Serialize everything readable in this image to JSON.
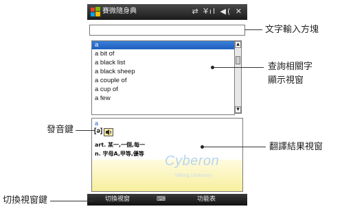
{
  "window": {
    "title": "賽微隨身典",
    "status_icons": "⇄ Y̶ıl ◀( ✕"
  },
  "input": {
    "value": ""
  },
  "word_list": {
    "items": [
      "a",
      "a bit of",
      "a black list",
      "a black sheep",
      "a couple of",
      "a cup of",
      "a few"
    ],
    "selected_index": 0
  },
  "result": {
    "word": "a",
    "phonetic": "[ə]",
    "definitions": [
      "art. 某一,一個,每一",
      "n. 字母A,甲等,優等"
    ],
    "watermark": "Cyberon",
    "watermark_sub": "Talking Dictionary"
  },
  "bottom_bar": {
    "left_softkey": "切換視窗",
    "keyboard_icon": "⌨",
    "right_softkey": "功能表"
  },
  "callouts": {
    "text_input": "文字輸入方塊",
    "related_words_line1": "查詢相關字",
    "related_words_line2": "顯示視窗",
    "pronounce": "發音鍵",
    "translation": "翻譯結果視窗",
    "switch_window": "切換視窗鍵"
  },
  "colors": {
    "selection": "#1f5fbf",
    "titlebar": "#2a2a2a",
    "result_background": "#f7ef9e"
  }
}
